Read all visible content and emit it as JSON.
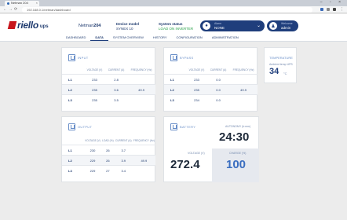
{
  "browser": {
    "tab_title": "Netman 204",
    "url": "192.168.0.1/netman/dashboard"
  },
  "header": {
    "logo": "riello",
    "logo_suffix": "ups",
    "product_prefix": "Netman",
    "product_suffix": "204",
    "device_model_label": "Device model",
    "device_model_value": "SYNEX 10",
    "system_status_label": "System status",
    "system_status_value": "LOAD ON INVERTER",
    "alarm_pill_label": "Alarm",
    "alarm_pill_value": "NONE",
    "user_pill_label": "Welcome",
    "user_pill_value": "admin"
  },
  "nav": {
    "tabs": [
      "DASHBOARD",
      "DATA",
      "SYSTEM OVERVIEW",
      "HISTORY",
      "CONFIGURATION",
      "ADMINISTRATION"
    ],
    "active": "DATA"
  },
  "input": {
    "title": "INPUT",
    "columns": [
      "VOLTAGE (V)",
      "CURRENT (A)",
      "FREQUENCY (Hz)"
    ],
    "rows": [
      {
        "phase": "L1",
        "values": [
          "233",
          "2.8",
          ""
        ]
      },
      {
        "phase": "L2",
        "values": [
          "235",
          "3.6",
          "49.9"
        ]
      },
      {
        "phase": "L3",
        "values": [
          "235",
          "3.5",
          ""
        ]
      }
    ]
  },
  "bypass": {
    "title": "BYPASS",
    "columns": [
      "VOLTAGE (V)",
      "CURRENT (A)",
      "FREQUENCY (Hz)"
    ],
    "rows": [
      {
        "phase": "L1",
        "values": [
          "233",
          "0.0",
          ""
        ]
      },
      {
        "phase": "L2",
        "values": [
          "235",
          "0.0",
          "49.9"
        ]
      },
      {
        "phase": "L3",
        "values": [
          "234",
          "0.0",
          ""
        ]
      }
    ]
  },
  "temperature": {
    "title": "TEMPERATURE",
    "subtitle": "Ambient temp UPS",
    "value": "34",
    "unit": "°C"
  },
  "output": {
    "title": "OUTPUT",
    "columns": [
      "VOLTAGE (V)",
      "LOAD (%)",
      "CURRENT (A)",
      "FREQUENCY (Hz)"
    ],
    "rows": [
      {
        "phase": "L1",
        "values": [
          "230",
          "26",
          "3.7",
          ""
        ]
      },
      {
        "phase": "L2",
        "values": [
          "229",
          "26",
          "3.9",
          "49.9"
        ]
      },
      {
        "phase": "L3",
        "values": [
          "229",
          "27",
          "3.4",
          ""
        ]
      }
    ]
  },
  "battery": {
    "title": "BATTERY",
    "runtime_label": "AUTONOMY (h:mm)",
    "runtime_value": "24:30",
    "voltage_label": "VOLTAGE (V)",
    "voltage_value": "272.4",
    "charge_label": "CHARGE (%)",
    "charge_value": "100"
  }
}
